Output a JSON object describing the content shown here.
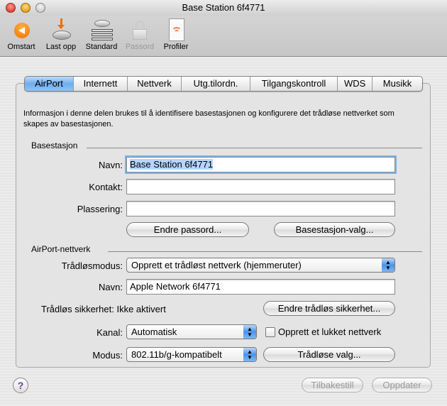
{
  "window": {
    "title": "Base Station 6f4771"
  },
  "toolbar": {
    "items": [
      {
        "label": "Omstart",
        "icon": "restart-icon",
        "enabled": true
      },
      {
        "label": "Last opp",
        "icon": "upload-icon",
        "enabled": true
      },
      {
        "label": "Standard",
        "icon": "default-icon",
        "enabled": true
      },
      {
        "label": "Passord",
        "icon": "lock-icon",
        "enabled": false
      },
      {
        "label": "Profiler",
        "icon": "profiles-icon",
        "enabled": true
      }
    ]
  },
  "tabs": [
    "AirPort",
    "Internett",
    "Nettverk",
    "Utg.tilordn.",
    "Tilgangskontroll",
    "WDS",
    "Musikk"
  ],
  "selected_tab": "AirPort",
  "description": "Informasjon i denne delen brukes til å identifisere basestasjonen og konfigurere det trådløse nettverket som skapes av basestasjonen.",
  "basestation": {
    "heading": "Basestasjon",
    "name_label": "Navn:",
    "name_value": "Base Station 6f4771",
    "contact_label": "Kontakt:",
    "contact_value": "",
    "location_label": "Plassering:",
    "location_value": "",
    "change_password": "Endre passord...",
    "options": "Basestasjon-valg..."
  },
  "network": {
    "heading": "AirPort-nettverk",
    "mode_label": "Trådløsmodus:",
    "mode_value": "Opprett et trådløst nettverk (hjemmeruter)",
    "name_label": "Navn:",
    "name_value": "Apple Network 6f4771",
    "security_label": "Trådløs sikkerhet:",
    "security_value": "Ikke aktivert",
    "change_security": "Endre trådløs sikkerhet...",
    "channel_label": "Kanal:",
    "channel_value": "Automatisk",
    "closed_network_label": "Opprett et lukket nettverk",
    "closed_network_checked": false,
    "radio_mode_label": "Modus:",
    "radio_mode_value": "802.11b/g-kompatibelt",
    "wireless_options": "Trådløse valg..."
  },
  "footer": {
    "help": "?",
    "revert": "Tilbakestill",
    "update": "Oppdater"
  }
}
